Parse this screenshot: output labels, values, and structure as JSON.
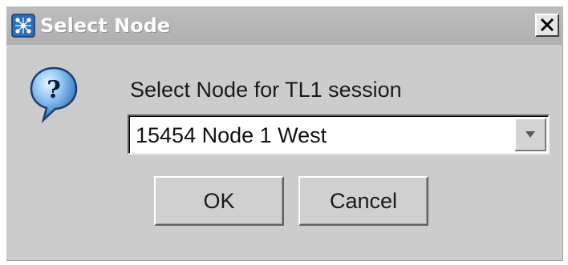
{
  "window": {
    "title": "Select Node",
    "close_label": "X"
  },
  "dialog": {
    "prompt": "Select Node for TL1 session",
    "icon": "question-icon"
  },
  "node_select": {
    "selected": "15454 Node 1 West"
  },
  "buttons": {
    "ok_label": "OK",
    "cancel_label": "Cancel"
  },
  "colors": {
    "dialog_bg": "#cccccc",
    "titlebar_bg": "#b5b5b5",
    "title_text": "#fdfdfd",
    "icon_blue": "#3a7bd5"
  }
}
